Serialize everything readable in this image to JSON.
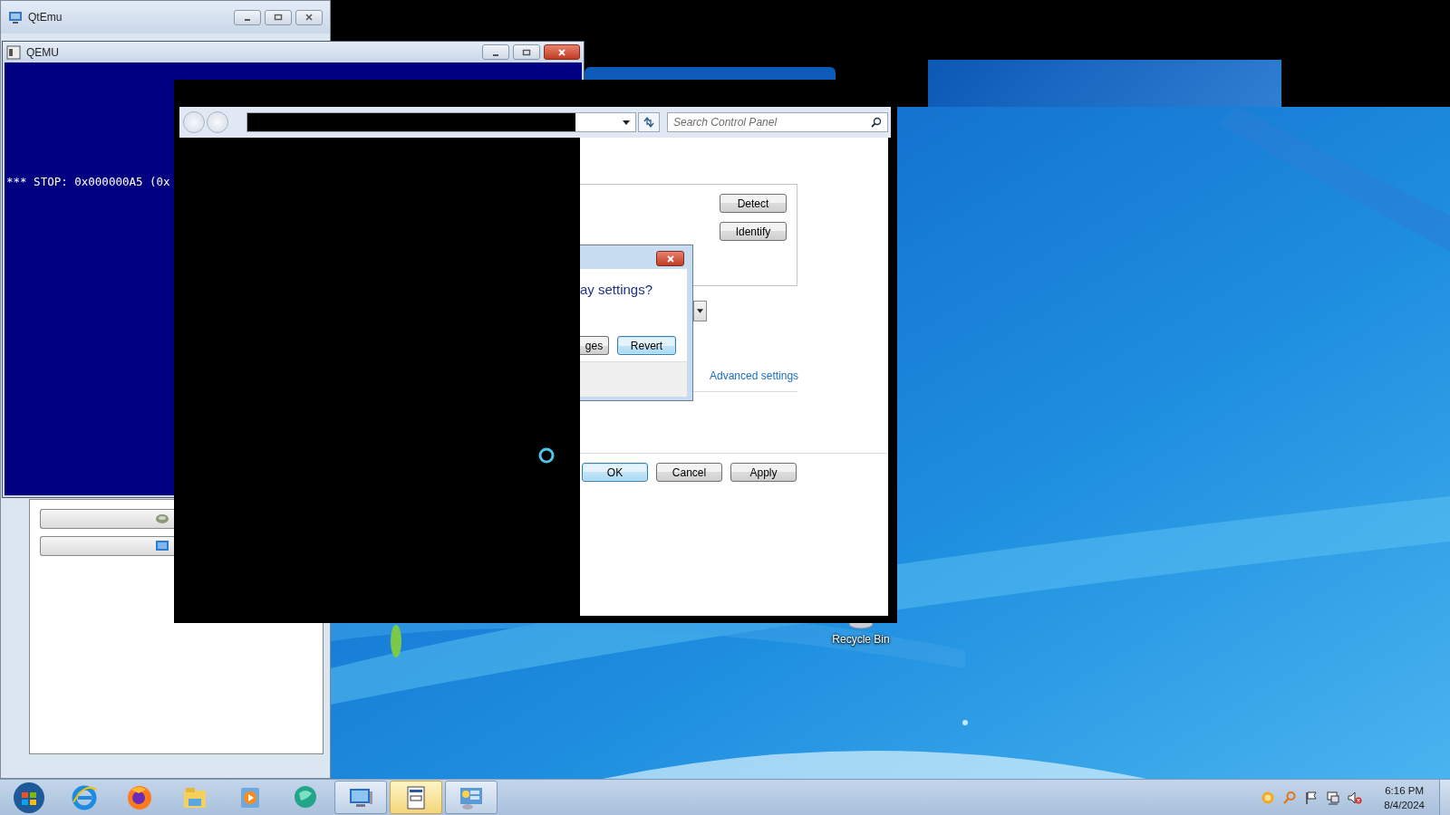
{
  "qtemu_window": {
    "title": "QtEmu",
    "list_buttons": [
      {
        "kind": "storage"
      },
      {
        "kind": "display"
      }
    ]
  },
  "qemu_window": {
    "title": "QEMU",
    "screen_text": "*** STOP: 0x000000A5 (0x"
  },
  "control_panel": {
    "search": {
      "placeholder": "Search Control Panel"
    },
    "monitor_buttons": [
      "Detect",
      "Identify"
    ],
    "link": "Advanced settings",
    "footer_buttons": [
      {
        "label": "OK",
        "default": true
      },
      {
        "label": "Cancel",
        "default": false
      },
      {
        "label": "Apply",
        "default": false
      }
    ]
  },
  "dialog": {
    "question": "ay settings?",
    "buttons": [
      {
        "label": "ges",
        "default": false
      },
      {
        "label": "Revert",
        "default": true
      }
    ]
  },
  "desktop_icons": [
    {
      "label": "Recycle Bin"
    }
  ],
  "taskbar": {
    "items": [
      {
        "kind": "start",
        "running": false,
        "active": false
      },
      {
        "kind": "browser-e",
        "running": false,
        "active": false
      },
      {
        "kind": "browser-fox",
        "running": false,
        "active": false
      },
      {
        "kind": "folder",
        "running": false,
        "active": false
      },
      {
        "kind": "media",
        "running": false,
        "active": false
      },
      {
        "kind": "globe",
        "running": false,
        "active": false
      },
      {
        "kind": "monitor",
        "running": true,
        "active": false
      },
      {
        "kind": "document",
        "running": true,
        "active": true
      },
      {
        "kind": "control-panel",
        "running": true,
        "active": false
      }
    ],
    "tray": [
      {
        "kind": "sun"
      },
      {
        "kind": "search"
      },
      {
        "kind": "flag"
      },
      {
        "kind": "network"
      },
      {
        "kind": "volume-muted"
      }
    ],
    "clock": {
      "time": "6:16 PM",
      "date": "8/4/2024"
    }
  }
}
